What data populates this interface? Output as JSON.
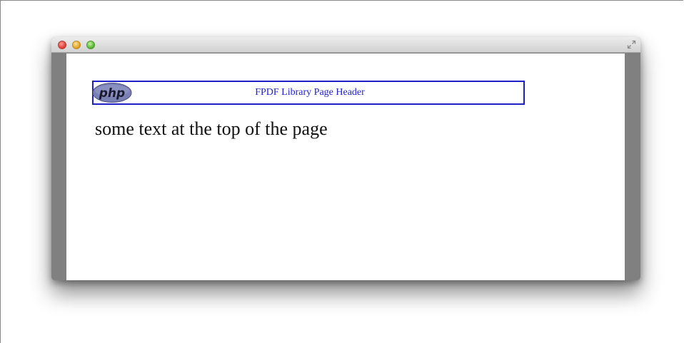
{
  "pdf_page": {
    "header": {
      "logo_text": "php",
      "title": "FPDF Library Page Header"
    },
    "body_text": "some text at the top of the page"
  },
  "colors": {
    "header_border": "#2020c8",
    "header_text": "#2020d0",
    "logo_fill": "#7b80b4"
  },
  "icons": {
    "window_close": "close-traffic-light-icon",
    "window_minimize": "minimize-traffic-light-icon",
    "window_zoom": "zoom-traffic-light-icon",
    "fullscreen": "fullscreen-arrows-icon",
    "logo": "php-logo-icon"
  }
}
